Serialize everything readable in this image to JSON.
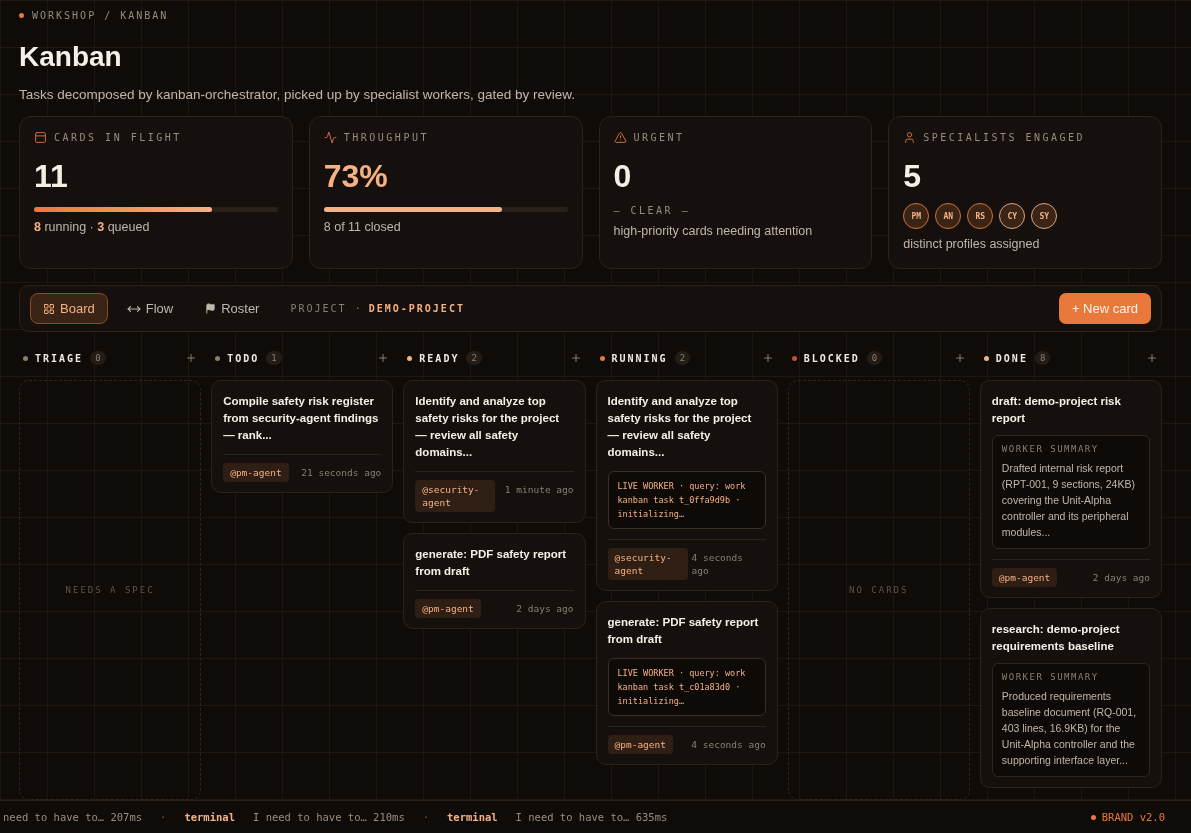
{
  "breadcrumb": "WORKSHOP / KANBAN",
  "title": "Kanban",
  "subtitle": "Tasks decomposed by kanban-orchestrator, picked up by specialist workers, gated by review.",
  "stats": [
    {
      "kind": "bar",
      "label": "CARDS IN FLIGHT",
      "value": "11",
      "level": 0.73,
      "note": "**8** running · **3** queued"
    },
    {
      "kind": "bar",
      "label": "THROUGHPUT",
      "value": "73%",
      "level": 0.73,
      "note": "8 of 11 closed"
    },
    {
      "kind": "status",
      "label": "URGENT",
      "value": "0",
      "status": "— CLEAR —",
      "note": "high-priority cards needing attention"
    },
    {
      "kind": "avatars",
      "label": "SPECIALISTS ENGAGED",
      "value": "5",
      "avatars": [
        "PM",
        "AN",
        "RS",
        "CY",
        "SY"
      ],
      "note": "distinct profiles assigned"
    }
  ],
  "tabs": [
    {
      "label": "Board",
      "selected": true
    },
    {
      "label": "Flow",
      "selected": false
    },
    {
      "label": "Roster",
      "selected": false
    }
  ],
  "project": {
    "label": "PROJECT",
    "separator": "·",
    "value": "DEMO-PROJECT"
  },
  "new_card_button": "+ New card",
  "columns": [
    {
      "name": "TRIAGE",
      "count": "0",
      "color": "#8a8070",
      "empty_text": "NEEDS A SPEC"
    },
    {
      "name": "TODO",
      "count": "1",
      "color": "#8a8070",
      "cards": [
        {
          "title": "Compile safety risk register from security-agent findings — rank...",
          "agent": "@pm-agent",
          "time": "21 seconds ago"
        }
      ]
    },
    {
      "name": "READY",
      "count": "2",
      "color": "#f5b183",
      "cards": [
        {
          "title": "Identify and analyze top safety risks for the project — review all safety domains...",
          "agent": "@security-agent",
          "time": "1 minute ago"
        },
        {
          "title": "generate: PDF safety report from draft",
          "agent": "@pm-agent",
          "time": "2 days ago"
        }
      ]
    },
    {
      "name": "RUNNING",
      "count": "2",
      "color": "#e8793a",
      "cards": [
        {
          "title": "Identify and analyze top safety risks for the project — review all safety domains...",
          "live": "LIVE WORKER · query: work kanban task t_0ffa9d9b · initializing…",
          "agent": "@security-agent",
          "time": "4 seconds ago"
        },
        {
          "title": "generate: PDF safety report from draft",
          "live": "LIVE WORKER · query: work kanban task t_c01a83d0 · initializing…",
          "agent": "@pm-agent",
          "time": "4 seconds ago"
        }
      ]
    },
    {
      "name": "BLOCKED",
      "count": "0",
      "color": "#c9502a",
      "empty_text": "NO CARDS"
    },
    {
      "name": "DONE",
      "count": "8",
      "color": "#f5b183",
      "cards": [
        {
          "title": "draft: demo-project risk report",
          "summary_label": "WORKER SUMMARY",
          "summary": "Drafted internal risk report (RPT-001, 9 sections, 24KB) covering the Unit-Alpha controller and its peripheral modules...",
          "agent": "@pm-agent",
          "time": "2 days ago"
        },
        {
          "title": "research: demo-project requirements baseline",
          "summary_label": "WORKER SUMMARY",
          "summary": "Produced requirements baseline document (RQ-001, 403 lines, 16.9KB) for the Unit-Alpha controller and the supporting interface layer..."
        }
      ]
    }
  ],
  "ticker": [
    {
      "text": "need to have to… 207ms"
    },
    {
      "separator": "·",
      "source": "terminal",
      "text": "I need to have to… 210ms"
    },
    {
      "separator": "·",
      "source": "terminal",
      "text": "I need to have to… 635ms"
    }
  ],
  "brand": "BRAND v2.0"
}
